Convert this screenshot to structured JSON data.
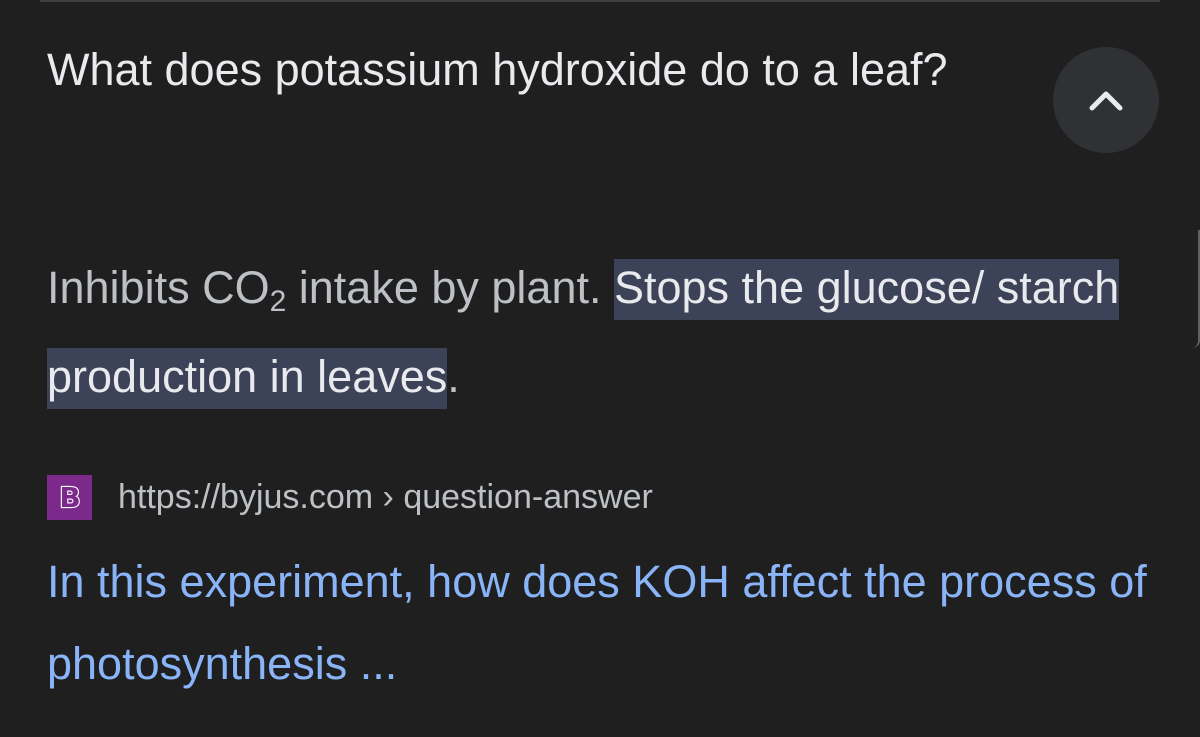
{
  "question": {
    "text": "What does potassium hydroxide do to a leaf?"
  },
  "answer": {
    "text_before_sub": "Inhibits CO",
    "subscript": "2",
    "text_after_sub": " intake by plant. ",
    "highlight": "Stops the glucose/ starch production in leaves",
    "trailing": "."
  },
  "source": {
    "favicon_letter": "B",
    "url": "https://byjus.com",
    "separator": " › ",
    "path": "question-answer"
  },
  "result": {
    "title": "In this experiment, how does KOH affect the process of photosynthesis ..."
  },
  "icons": {
    "collapse": "chevron-up-icon",
    "favicon": "byjus-favicon-icon"
  },
  "colors": {
    "background": "#1f1f1f",
    "highlight_bg": "#3c4257",
    "link": "#8ab4f8",
    "favicon_bg": "#7b2a8c"
  }
}
